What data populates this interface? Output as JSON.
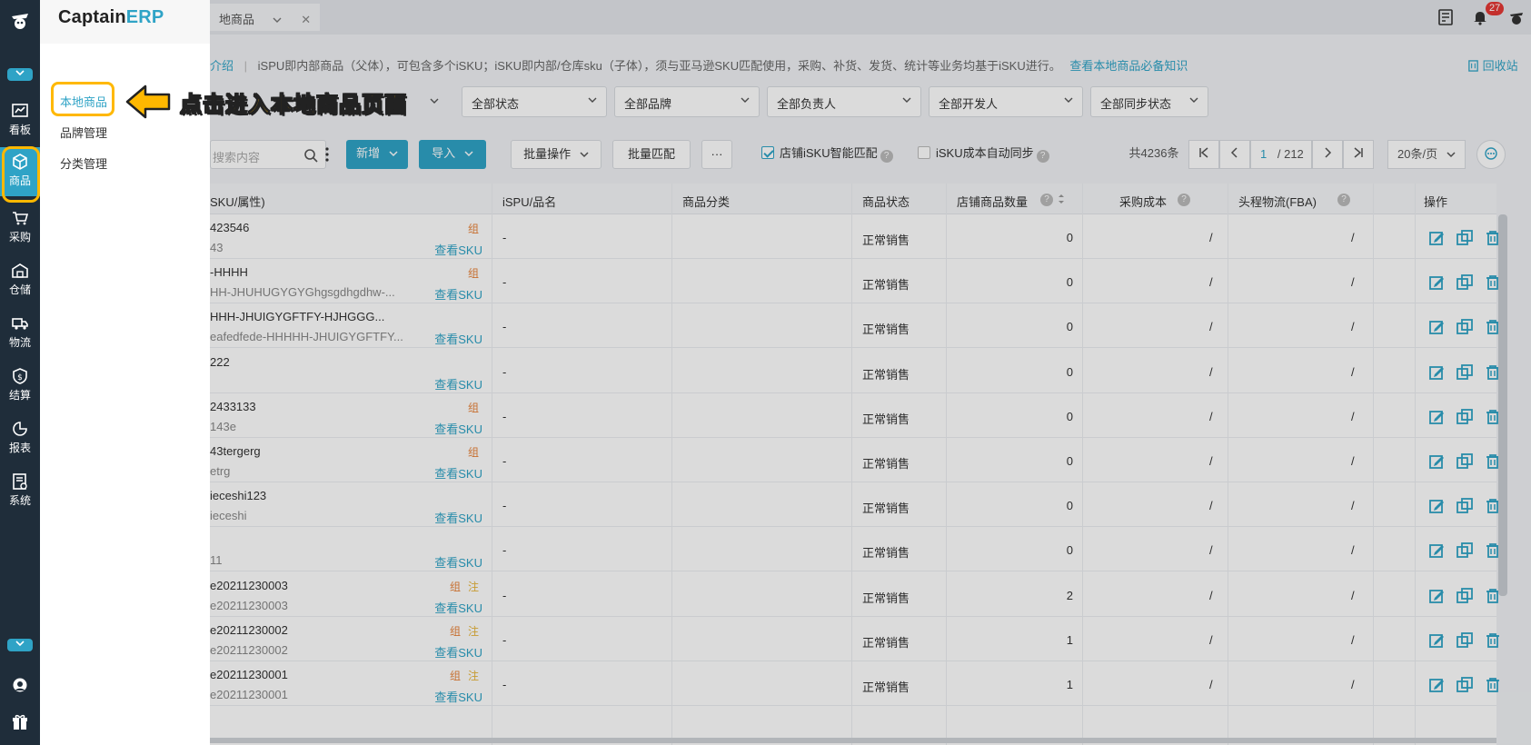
{
  "brand": {
    "name_main": "Captain",
    "name_accent": "ERP"
  },
  "rail": {
    "items": [
      {
        "label": "看板"
      },
      {
        "label": "商品"
      },
      {
        "label": "采购"
      },
      {
        "label": "仓储"
      },
      {
        "label": "物流"
      },
      {
        "label": "结算"
      },
      {
        "label": "报表"
      },
      {
        "label": "系统"
      }
    ]
  },
  "submenu": {
    "items": [
      {
        "label": "本地商品"
      },
      {
        "label": "品牌管理"
      },
      {
        "label": "分类管理"
      }
    ]
  },
  "callout": {
    "text": "点击进入本地商品页面"
  },
  "topbar": {
    "tab_label": "地商品",
    "tab_close": "✕",
    "notification_count": "27"
  },
  "info": {
    "prefix": "介绍",
    "text": "iSPU即内部商品（父体），可包含多个iSKU；iSKU即内部/仓库sku（子体），须与亚马逊SKU匹配使用，采购、补货、发货、统计等业务均基于iSKU进行。",
    "link": "查看本地商品必备知识",
    "recycle": "回收站"
  },
  "filters": [
    "全部状态",
    "全部品牌",
    "全部负责人",
    "全部开发人",
    "全部同步状态"
  ],
  "toolbar": {
    "search_placeholder": "搜索内容",
    "add": "新增",
    "import": "导入",
    "batch_ops": "批量操作",
    "batch_match": "批量匹配",
    "more": "···",
    "smart_match": "店铺iSKU智能匹配",
    "cost_sync": "iSKU成本自动同步",
    "total": "共4236条",
    "page_current": "1",
    "page_total": "/ 212",
    "page_size": "20条/页"
  },
  "table": {
    "columns": [
      "SKU/属性)",
      "iSPU/品名",
      "商品分类",
      "商品状态",
      "店铺商品数量",
      "采购成本",
      "头程物流(FBA)",
      "操作"
    ],
    "view_sku_label": "查看SKU",
    "rows": [
      {
        "sku": "423546",
        "sub": "43",
        "tags": [
          "组"
        ],
        "ispu": "-",
        "status": "正常销售",
        "qty": "0",
        "cost": "/",
        "fba": "/"
      },
      {
        "sku": "-HHHH",
        "sub": "HH-JHUHUGYGYGhgsgdhgdhw-...",
        "tags": [
          "组"
        ],
        "ispu": "-",
        "status": "正常销售",
        "qty": "0",
        "cost": "/",
        "fba": "/"
      },
      {
        "sku": "HHH-JHUIGYGFTFY-HJHGGG...",
        "sub": "eafedfede-HHHHH-JHUIGYGFTFY...",
        "tags": [],
        "ispu": "-",
        "status": "正常销售",
        "qty": "0",
        "cost": "/",
        "fba": "/"
      },
      {
        "sku": "222",
        "sub": "",
        "tags": [],
        "ispu": "-",
        "status": "正常销售",
        "qty": "0",
        "cost": "/",
        "fba": "/"
      },
      {
        "sku": "2433133",
        "sub": "143e",
        "tags": [
          "组"
        ],
        "ispu": "-",
        "status": "正常销售",
        "qty": "0",
        "cost": "/",
        "fba": "/"
      },
      {
        "sku": "43tergerg",
        "sub": "etrg",
        "tags": [
          "组"
        ],
        "ispu": "-",
        "status": "正常销售",
        "qty": "0",
        "cost": "/",
        "fba": "/"
      },
      {
        "sku": "ieceshi123",
        "sub": "ieceshi",
        "tags": [],
        "ispu": "-",
        "status": "正常销售",
        "qty": "0",
        "cost": "/",
        "fba": "/"
      },
      {
        "sku": "",
        "sub": "11",
        "tags": [],
        "ispu": "-",
        "status": "正常销售",
        "qty": "0",
        "cost": "/",
        "fba": "/"
      },
      {
        "sku": "e20211230003",
        "sub": "e20211230003",
        "tags": [
          "组",
          "注"
        ],
        "ispu": "-",
        "status": "正常销售",
        "qty": "2",
        "cost": "/",
        "fba": "/"
      },
      {
        "sku": "e20211230002",
        "sub": "e20211230002",
        "tags": [
          "组",
          "注"
        ],
        "ispu": "-",
        "status": "正常销售",
        "qty": "1",
        "cost": "/",
        "fba": "/"
      },
      {
        "sku": "e20211230001",
        "sub": "e20211230001",
        "tags": [
          "组",
          "注"
        ],
        "ispu": "-",
        "status": "正常销售",
        "qty": "1",
        "cost": "/",
        "fba": "/"
      }
    ]
  },
  "colors": {
    "accent": "#2fa3c6",
    "rail": "#1f2d3a",
    "highlight": "#ffb800",
    "tag_zu": "#e8833a",
    "tag_zhu": "#e8b53a"
  }
}
